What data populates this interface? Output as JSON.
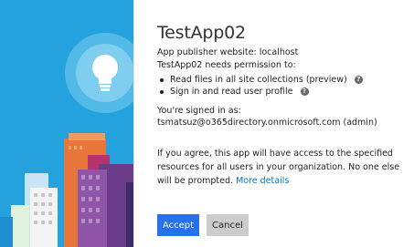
{
  "app": {
    "title": "TestApp02",
    "publisher_line": "App publisher website: localhost",
    "needs_permission": "TestApp02 needs permission to:"
  },
  "permissions": [
    {
      "label": "Read files in all site collections (preview)",
      "help_icon": "question-circle-icon"
    },
    {
      "label": "Sign in and read user profile",
      "help_icon": "question-circle-icon"
    }
  ],
  "help_glyph": "?",
  "signin": {
    "text": "You're signed in as: tsmatsuz@o365directory.onmicrosoft.com (admin)"
  },
  "consent": {
    "text": "If you agree, this app will have access to the specified resources for all users in your organization. No one else will be prompted.",
    "link": "More details"
  },
  "buttons": {
    "accept": "Accept",
    "cancel": "Cancel"
  },
  "colors": {
    "hero_background": "#23a2dd",
    "accept_button": "#2672ec",
    "cancel_button": "#cccccc",
    "link": "#0072c6"
  },
  "hero_icon": "lightbulb-icon"
}
